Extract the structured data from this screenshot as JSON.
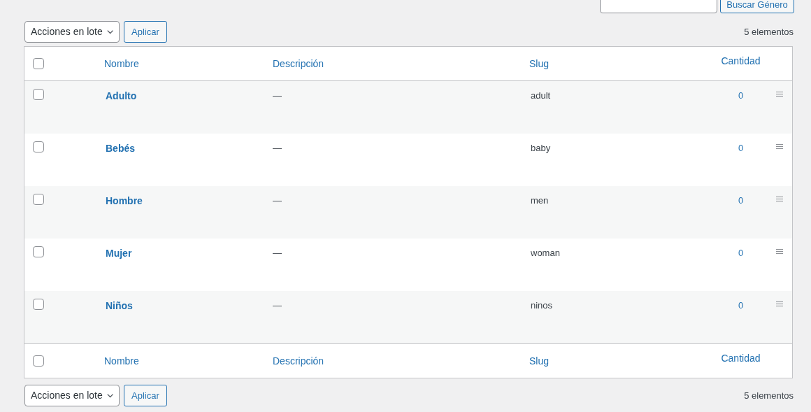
{
  "search": {
    "button": "Buscar Género"
  },
  "bulk_top": {
    "select": "Acciones en lote",
    "apply": "Aplicar",
    "count": "5 elementos"
  },
  "table": {
    "columns": [
      "Nombre",
      "Descripción",
      "Slug",
      "Cantidad"
    ],
    "header_checked": false,
    "rows": [
      {
        "name": "Adulto",
        "description": "—",
        "slug": "adult",
        "count": "0",
        "checked": false
      },
      {
        "name": "Bebés",
        "description": "—",
        "slug": "baby",
        "count": "0",
        "checked": false
      },
      {
        "name": "Hombre",
        "description": "—",
        "slug": "men",
        "count": "0",
        "checked": false
      },
      {
        "name": "Mujer",
        "description": "—",
        "slug": "woman",
        "count": "0",
        "checked": false
      },
      {
        "name": "Niños",
        "description": "—",
        "slug": "ninos",
        "count": "0",
        "checked": false
      }
    ],
    "footer_columns": [
      "Nombre",
      "Descripción",
      "Slug",
      "Cantidad"
    ],
    "footer_checked": false
  },
  "bulk_bottom": {
    "select": "Acciones en lote",
    "apply": "Aplicar",
    "count": "5 elementos"
  }
}
